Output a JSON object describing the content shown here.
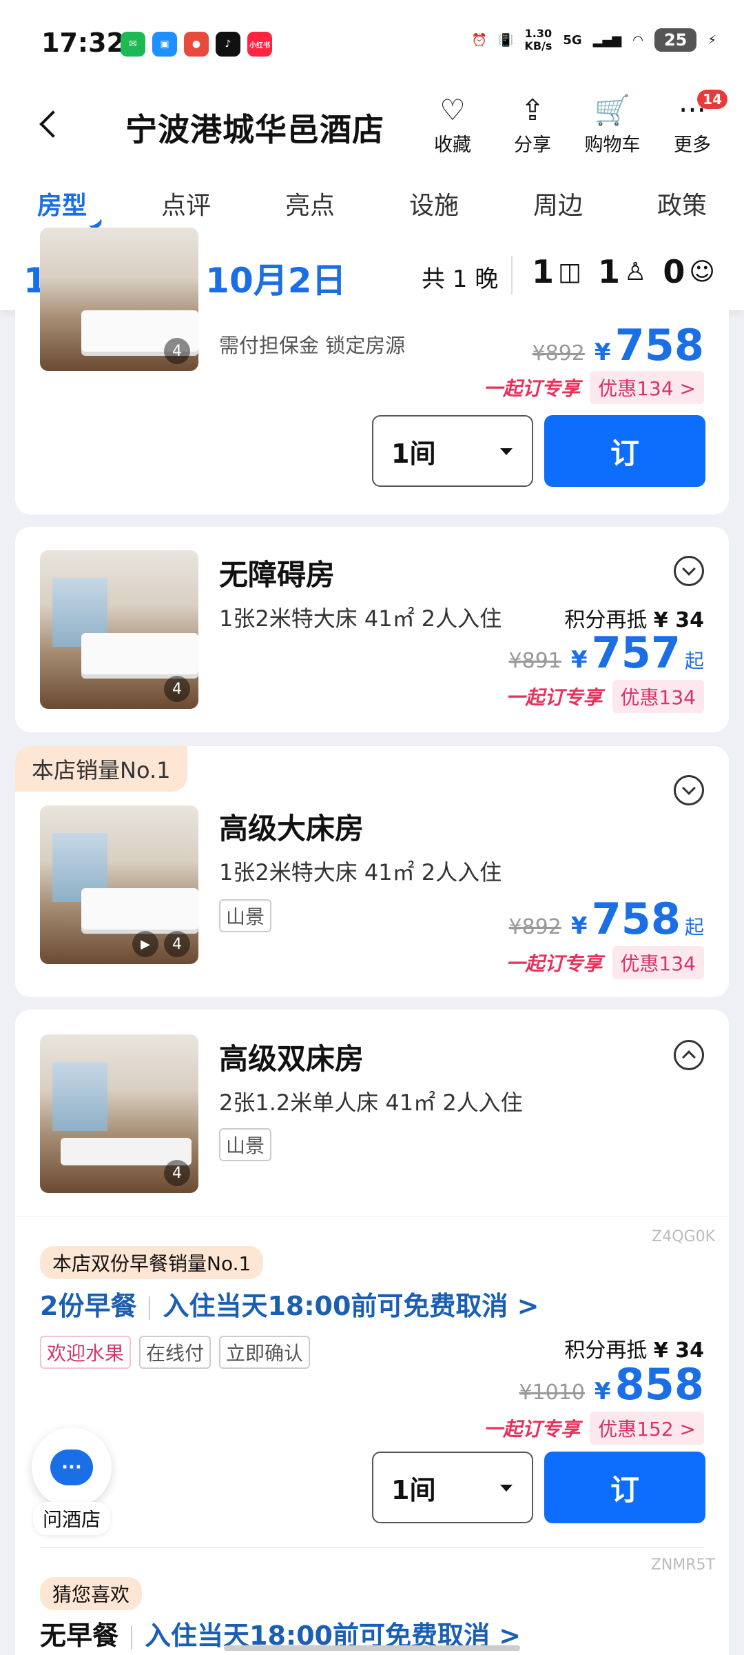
{
  "status_bar": {
    "time": "17:32",
    "apps": [
      {
        "name": "wechat",
        "text": "✉",
        "color": "#1db954"
      },
      {
        "name": "app-blue",
        "text": "▣",
        "color": "#1e90ff"
      },
      {
        "name": "app-red",
        "text": "●",
        "color": "#e84b3c"
      },
      {
        "name": "tiktok",
        "text": "♪",
        "color": "#111111"
      },
      {
        "name": "xiaohongshu",
        "text": "小红书",
        "color": "#ff2442"
      }
    ],
    "speed_value": "1.30",
    "speed_unit": "KB/s",
    "network": "5G",
    "battery": "25"
  },
  "header": {
    "title": "宁波港城华邑酒店",
    "actions": [
      {
        "label": "收藏",
        "icon": "heart-plus-icon",
        "glyph": "♡"
      },
      {
        "label": "分享",
        "icon": "share-icon",
        "glyph": "⇪"
      },
      {
        "label": "购物车",
        "icon": "cart-icon",
        "glyph": "🛒"
      },
      {
        "label": "更多",
        "icon": "more-icon",
        "glyph": "···",
        "badge": "14"
      }
    ]
  },
  "tabs": [
    "房型",
    "点评",
    "亮点",
    "设施",
    "周边",
    "政策"
  ],
  "date_bar": {
    "dates": "10月1日 – 10月2日",
    "nights": "共 1 晚",
    "rooms": "1",
    "adults": "1",
    "children": "0"
  },
  "top_card": {
    "note": "需付担保金 锁定房源",
    "orig_price": "¥892",
    "yen": "¥",
    "price": "758",
    "promo_brand": "一起订专享",
    "promo_discount": "优惠134 >",
    "qty": "1间",
    "book": "订",
    "photos": "4"
  },
  "rooms": [
    {
      "name": "无障碍房",
      "spec": "1张2米特大床  41㎡  2人入住",
      "points_label": "积分再抵",
      "points_value": "¥ 34",
      "orig_price": "¥891",
      "yen": "¥",
      "price": "757",
      "qi": "起",
      "promo_brand": "一起订专享",
      "promo_discount": "优惠134",
      "photos": "4"
    },
    {
      "badge": "本店销量No.1",
      "name": "高级大床房",
      "spec": "1张2米特大床  41㎡  2人入住",
      "tag": "山景",
      "orig_price": "¥892",
      "yen": "¥",
      "price": "758",
      "qi": "起",
      "promo_brand": "一起订专享",
      "promo_discount": "优惠134",
      "photos": "4"
    },
    {
      "name": "高级双床房",
      "spec": "2张1.2米单人床  41㎡  2人入住",
      "tag": "山景",
      "photos": "4"
    }
  ],
  "package": {
    "code": "Z4QG0K",
    "badge": "本店双份早餐销量No.1",
    "breakfast": "2份早餐",
    "cancel": "入住当天18:00前可免费取消 >",
    "tags": [
      "欢迎水果",
      "在线付",
      "立即确认"
    ],
    "points_label": "积分再抵",
    "points_value": "¥ 34",
    "orig_price": "¥1010",
    "yen": "¥",
    "price": "858",
    "promo_brand": "一起订专享",
    "promo_discount": "优惠152 >",
    "qty": "1间",
    "book": "订"
  },
  "package2": {
    "code": "ZNMR5T",
    "badge": "猜您喜欢",
    "breakfast": "无早餐",
    "cancel": "入住当天18:00前可免费取消 >"
  },
  "ask": {
    "label": "问酒店",
    "bubble": "···"
  }
}
